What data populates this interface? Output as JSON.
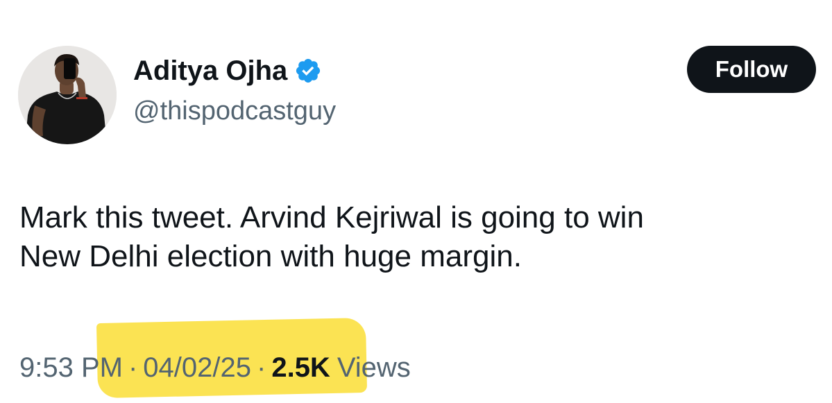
{
  "author": {
    "display_name": "Aditya Ojha",
    "handle": "@thispodcastguy",
    "verified": true
  },
  "follow_button": {
    "label": "Follow"
  },
  "tweet": {
    "text_lines": [
      "Mark this tweet. Arvind Kejriwal is going to win",
      "New Delhi election with huge margin."
    ]
  },
  "meta": {
    "time": "9:53 PM",
    "separator": "·",
    "date": "04/02/25",
    "views_count": "2.5K",
    "views_label": "Views"
  },
  "icons": {
    "verified": "verified-badge-icon",
    "avatar": "profile-photo"
  },
  "colors": {
    "text_primary": "#0f1419",
    "text_secondary": "#536471",
    "verified_blue": "#1d9bf0",
    "follow_bg": "#0f1419",
    "highlight": "#fbe14a"
  }
}
